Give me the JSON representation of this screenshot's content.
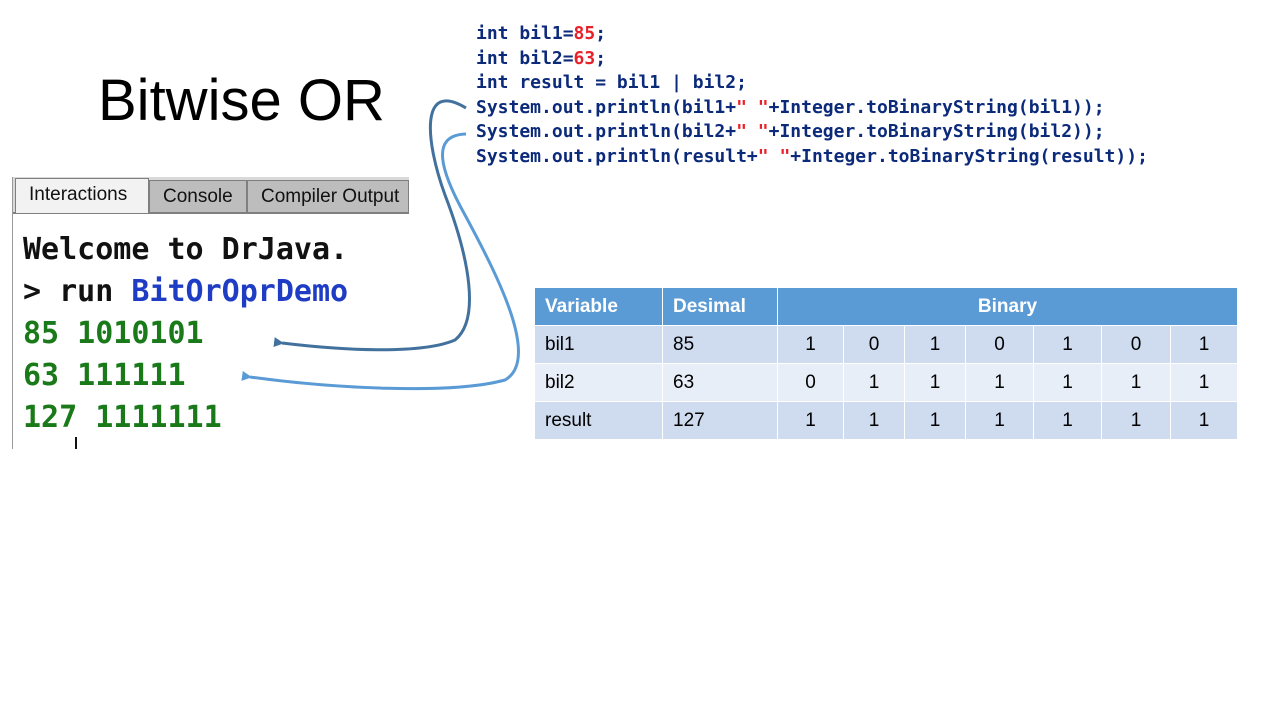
{
  "slide": {
    "title": "Bitwise OR"
  },
  "code": {
    "line1": {
      "kw": "int bil1=",
      "num": "85",
      "end": ";"
    },
    "line2": {
      "kw": "int bil2=",
      "num": "63",
      "end": ";"
    },
    "line3": "int result = bil1 | bil2;",
    "line4": {
      "a": "System.out.println(bil1+",
      "s": "\" \"",
      "b": "+Integer.toBinaryString(bil1));"
    },
    "line5": {
      "a": "System.out.println(bil2+",
      "s": "\" \"",
      "b": "+Integer.toBinaryString(bil2));"
    },
    "line6": {
      "a": "System.out.println(result+",
      "s": "\" \"",
      "b": "+Integer.toBinaryString(result));"
    }
  },
  "drjava": {
    "tabs": [
      "Interactions",
      "Console",
      "Compiler Output"
    ],
    "welcome": "Welcome to DrJava.",
    "prompt": "> run ",
    "class_name": "BitOrOprDemo",
    "outputs": [
      "85 1010101",
      "63 111111",
      "127 1111111"
    ]
  },
  "table": {
    "headers": [
      "Variable",
      "Desimal",
      "Binary"
    ],
    "rows": [
      {
        "name": "bil1",
        "decimal": "85",
        "bits": [
          "1",
          "0",
          "1",
          "0",
          "1",
          "0",
          "1"
        ]
      },
      {
        "name": "bil2",
        "decimal": "63",
        "bits": [
          "0",
          "1",
          "1",
          "1",
          "1",
          "1",
          "1"
        ]
      },
      {
        "name": "result",
        "decimal": "127",
        "bits": [
          "1",
          "1",
          "1",
          "1",
          "1",
          "1",
          "1"
        ]
      }
    ]
  },
  "colors": {
    "table_header": "#5b9bd5",
    "row_odd": "#cfdcef",
    "row_even": "#e8eef7",
    "code_keyword": "#0b2a7a",
    "code_literal": "#e8202a",
    "console_output": "#1a7a1a",
    "arrow_dark": "#41719c",
    "arrow_light": "#5b9bd5"
  }
}
